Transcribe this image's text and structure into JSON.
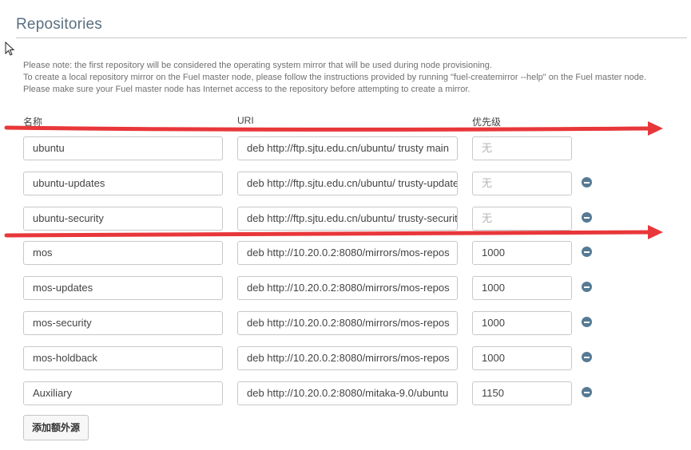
{
  "section": {
    "title": "Repositories"
  },
  "notes": [
    "Please note: the first repository will be considered the operating system mirror that will be used during node provisioning.",
    "To create a local repository mirror on the Fuel master node, please follow the instructions provided by running \"fuel-createmirror --help\" on the Fuel master node.",
    "Please make sure your Fuel master node has Internet access to the repository before attempting to create a mirror."
  ],
  "columns": {
    "name": "名称",
    "uri": "URI",
    "priority": "优先级"
  },
  "repositories": [
    {
      "name": "ubuntu",
      "uri": "deb http://ftp.sjtu.edu.cn/ubuntu/ trusty main",
      "priority": "",
      "priority_placeholder": "无",
      "removable": false
    },
    {
      "name": "ubuntu-updates",
      "uri": "deb http://ftp.sjtu.edu.cn/ubuntu/ trusty-updates",
      "priority": "",
      "priority_placeholder": "无",
      "removable": true
    },
    {
      "name": "ubuntu-security",
      "uri": "deb http://ftp.sjtu.edu.cn/ubuntu/ trusty-security",
      "priority": "",
      "priority_placeholder": "无",
      "removable": true
    },
    {
      "name": "mos",
      "uri": "deb http://10.20.0.2:8080/mirrors/mos-repos",
      "priority": "1000",
      "priority_placeholder": "",
      "removable": true
    },
    {
      "name": "mos-updates",
      "uri": "deb http://10.20.0.2:8080/mirrors/mos-repos",
      "priority": "1000",
      "priority_placeholder": "",
      "removable": true
    },
    {
      "name": "mos-security",
      "uri": "deb http://10.20.0.2:8080/mirrors/mos-repos",
      "priority": "1000",
      "priority_placeholder": "",
      "removable": true
    },
    {
      "name": "mos-holdback",
      "uri": "deb http://10.20.0.2:8080/mirrors/mos-repos",
      "priority": "1000",
      "priority_placeholder": "",
      "removable": true
    },
    {
      "name": "Auxiliary",
      "uri": "deb http://10.20.0.2:8080/mitaka-9.0/ubuntu",
      "priority": "1150",
      "priority_placeholder": "",
      "removable": true
    }
  ],
  "add_button": {
    "label": "添加额外源"
  },
  "colors": {
    "annotation_arrow": "#e8373a",
    "remove_icon": "#567a94",
    "title": "#5a6f80"
  },
  "icons": {
    "remove": "minus-circle-icon",
    "cursor": "mouse-cursor-icon"
  }
}
